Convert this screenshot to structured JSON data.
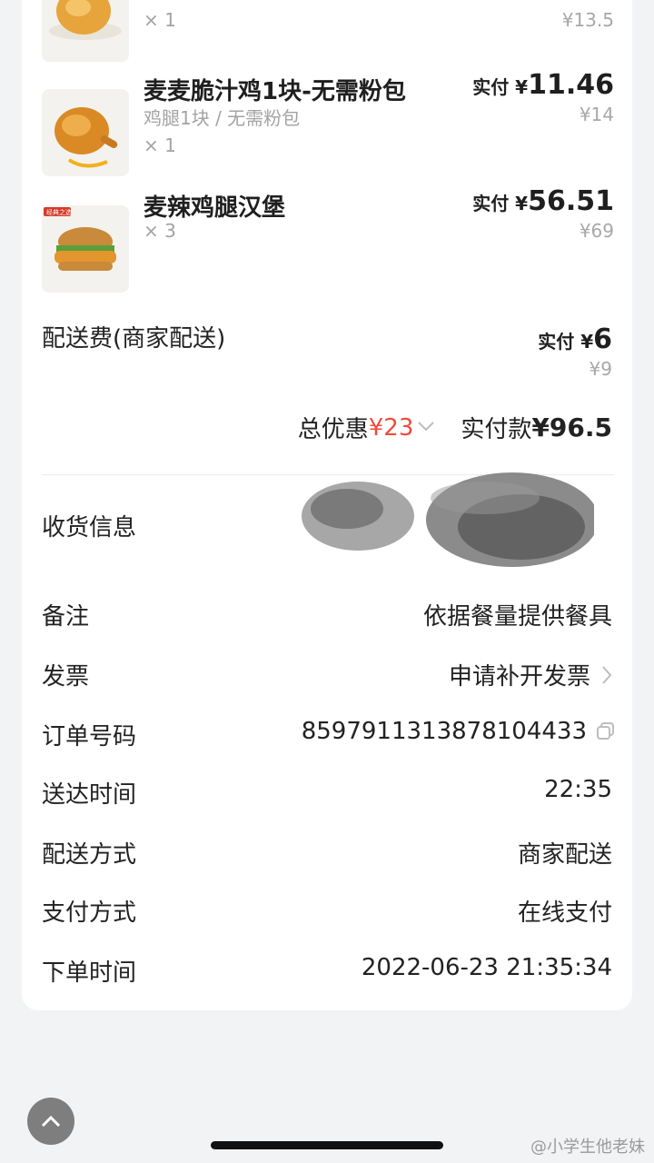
{
  "items": [
    {
      "name": "",
      "spec": "",
      "qty": "× 1",
      "paid_label": "",
      "paid_amount": "",
      "original": "¥13.5"
    },
    {
      "name": "麦麦脆汁鸡1块-无需粉包",
      "spec": "鸡腿1块 / 无需粉包",
      "qty": "× 1",
      "paid_label": "实付 ¥",
      "paid_amount": "11.46",
      "original": "¥14"
    },
    {
      "name": "麦辣鸡腿汉堡",
      "spec": "",
      "qty": "× 3",
      "paid_label": "实付 ¥",
      "paid_amount": "56.51",
      "original": "¥69",
      "badge": "经典之选"
    }
  ],
  "delivery_fee": {
    "label": "配送费(商家配送)",
    "paid_label": "实付 ¥",
    "paid_amount": "6",
    "original": "¥9"
  },
  "summary": {
    "discount_label": "总优惠",
    "discount_value": "¥23",
    "total_label": "实付款",
    "total_value": "¥96.5"
  },
  "info_rows": {
    "shipping": {
      "label": "收货信息"
    },
    "remark": {
      "label": "备注",
      "value": "依据餐量提供餐具"
    },
    "invoice": {
      "label": "发票",
      "value": "申请补开发票"
    },
    "order_no": {
      "label": "订单号码",
      "value": "8597911313878104433"
    },
    "delivered": {
      "label": "送达时间",
      "value": "22:35"
    },
    "delivery_method": {
      "label": "配送方式",
      "value": "商家配送"
    },
    "payment": {
      "label": "支付方式",
      "value": "在线支付"
    },
    "order_time": {
      "label": "下单时间",
      "value": "2022-06-23 21:35:34"
    }
  },
  "watermark": "@小学生他老妹",
  "colors": {
    "accent_red": "#f04a3c",
    "muted": "#a8a8a8"
  }
}
